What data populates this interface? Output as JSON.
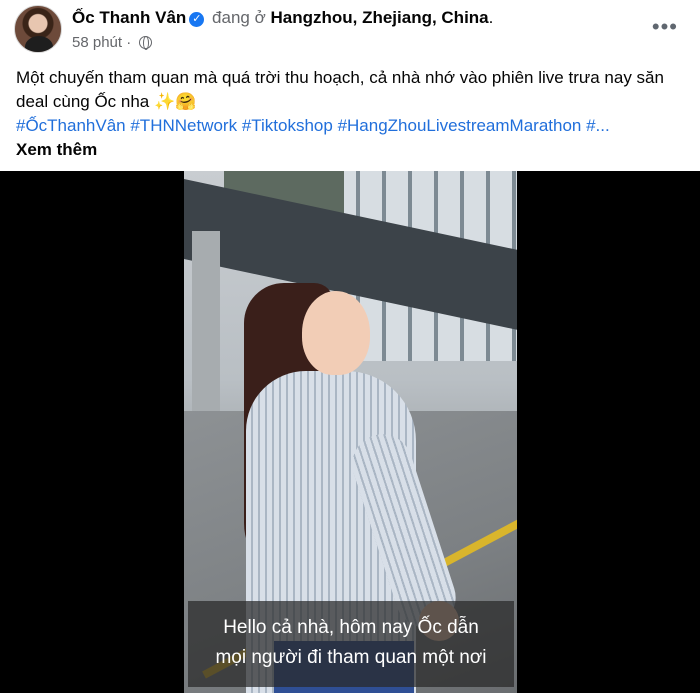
{
  "post": {
    "author": "Ốc Thanh Vân",
    "verified_icon": "verified-badge-icon",
    "location_prefix": "đang ở",
    "location": "Hangzhou, Zhejiang, China",
    "location_suffix": ".",
    "time": "58 phút",
    "separator": "·",
    "audience_icon": "globe-icon",
    "more_label": "•••",
    "caption": "Một chuyến tham quan mà quá trời thu hoạch, cả nhà nhớ vào phiên live trưa nay săn deal cùng Ốc nha ✨🤗",
    "hashtags": "#ỐcThanhVân #THNNetwork #Tiktokshop #HangZhouLivestreamMarathon #...",
    "see_more": "Xem thêm"
  },
  "video": {
    "subtitle_line1": "Hello cả nhà, hôm nay Ốc dẫn",
    "subtitle_line2": "mọi người đi tham quan một nơi"
  },
  "colors": {
    "link": "#216fdb",
    "verified": "#1877f2",
    "muted": "#65676b"
  }
}
